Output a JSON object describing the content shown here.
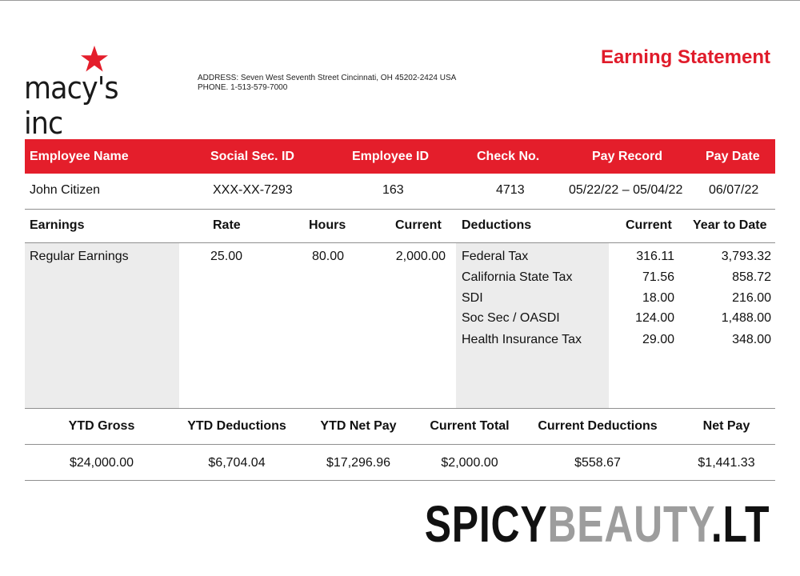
{
  "header": {
    "logo_text": "macy's inc",
    "address": "ADDRESS: Seven West Seventh Street Cincinnati, OH 45202-2424 USA",
    "phone": "PHONE. 1-513-579-7000",
    "title": "Earning Statement"
  },
  "employee_table": {
    "columns": [
      "Employee Name",
      "Social Sec. ID",
      "Employee ID",
      "Check No.",
      "Pay Record",
      "Pay Date"
    ],
    "row": [
      "John Citizen",
      "XXX-XX-7293",
      "163",
      "4713",
      "05/22/22 – 05/04/22",
      "06/07/22"
    ]
  },
  "earnings": {
    "columns": [
      "Earnings",
      "Rate",
      "Hours",
      "Current"
    ],
    "rows": [
      {
        "label": "Regular Earnings",
        "rate": "25.00",
        "hours": "80.00",
        "current": "2,000.00"
      }
    ]
  },
  "deductions": {
    "columns": [
      "Deductions",
      "Current",
      "Year to Date"
    ],
    "rows": [
      {
        "label": "Federal Tax",
        "current": "316.11",
        "ytd": "3,793.32"
      },
      {
        "label": "California State Tax",
        "current": "71.56",
        "ytd": "858.72"
      },
      {
        "label": "SDI",
        "current": "18.00",
        "ytd": "216.00"
      },
      {
        "label": "Soc Sec / OASDI",
        "current": "124.00",
        "ytd": "1,488.00"
      },
      {
        "label": "Health Insurance Tax",
        "current": "29.00",
        "ytd": "348.00"
      }
    ]
  },
  "summary": {
    "columns": [
      "YTD Gross",
      "YTD Deductions",
      "YTD Net Pay",
      "Current Total",
      "Current Deductions",
      "Net Pay"
    ],
    "values": [
      "$24,000.00",
      "$6,704.04",
      "$17,296.96",
      "$2,000.00",
      "$558.67",
      "$1,441.33"
    ]
  },
  "watermark": {
    "part1": "SPICY",
    "part2": "BEAUTY",
    "part3": ".LT"
  },
  "colors": {
    "brand_red": "#e41e2b",
    "title_red": "#e01b2a",
    "shade": "#ececec"
  }
}
